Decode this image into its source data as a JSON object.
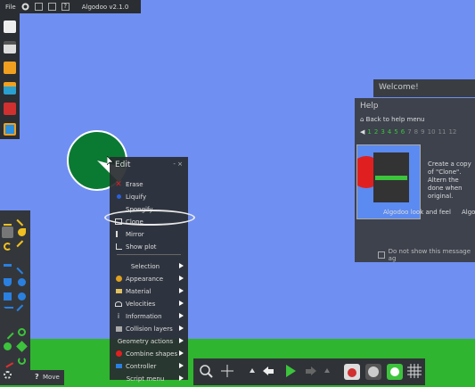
{
  "colors": {
    "sky": "#6f8ff2",
    "ground": "#2fb52f",
    "circle": "#0a7a32",
    "accent": "#3cc43c"
  },
  "topbar": {
    "file_label": "File",
    "title": "Algodoo v2.1.0"
  },
  "edit_menu": {
    "title": "Edit",
    "window_buttons": "- ×",
    "items": [
      {
        "label": "Erase",
        "icon": "red-x-icon"
      },
      {
        "label": "Liquify",
        "icon": "blue-dot-icon"
      },
      {
        "label": "Spongify",
        "icon": ""
      },
      {
        "label": "Clone",
        "icon": "clone-icon"
      },
      {
        "label": "Mirror",
        "icon": "mirror-icon"
      },
      {
        "label": "Show plot",
        "icon": "plot-icon"
      },
      {
        "label": "Selection",
        "submenu": true
      },
      {
        "label": "Appearance",
        "icon": "palette-icon",
        "submenu": true
      },
      {
        "label": "Material",
        "icon": "material-icon",
        "submenu": true
      },
      {
        "label": "Velocities",
        "icon": "velocity-icon",
        "submenu": true
      },
      {
        "label": "Information",
        "icon": "info-icon",
        "submenu": true
      },
      {
        "label": "Collision layers",
        "icon": "layers-icon",
        "submenu": true
      },
      {
        "label": "Geometry actions",
        "submenu": true
      },
      {
        "label": "Combine shapes",
        "icon": "combine-icon",
        "submenu": true
      },
      {
        "label": "Controller",
        "icon": "controller-icon",
        "submenu": true
      },
      {
        "label": "Script menu",
        "submenu": true
      }
    ]
  },
  "move_tool": {
    "key": "?",
    "label": "Move"
  },
  "help": {
    "welcome_title": "Welcome!",
    "title": "Help",
    "back_label": "Back to help menu",
    "pages": [
      "1",
      "2",
      "3",
      "4",
      "5",
      "6",
      "7",
      "8",
      "9",
      "10",
      "11",
      "12"
    ],
    "description": "Create a copy of \"Clone\". Altern the done when original.",
    "caption_left": "Algodoo look and feel",
    "caption_right": "Algo",
    "dont_show": "Do not show this message ag"
  }
}
